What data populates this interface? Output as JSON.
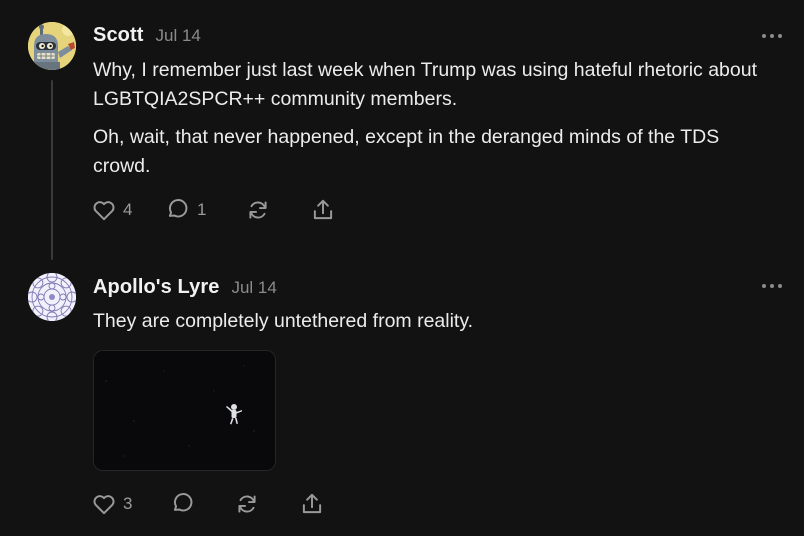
{
  "comments": [
    {
      "author": "Scott",
      "date": "Jul 14",
      "paragraphs": [
        "Why, I remember just last week when Trump was using hateful rhetoric about LGBTQIA2SPCR++ community members.",
        "Oh, wait, that never happened, except in the deranged minds of the TDS crowd."
      ],
      "likes": "4",
      "replies": "1",
      "avatar_icon": "robot-cartoon-avatar"
    },
    {
      "author": "Apollo's Lyre",
      "date": "Jul 14",
      "paragraphs": [
        "They are completely untethered from reality."
      ],
      "likes": "3",
      "replies": "",
      "avatar_icon": "mandala-pattern-avatar",
      "media": "astronaut-floating-in-space-image"
    }
  ],
  "colors": {
    "background": "#121212",
    "text": "#ececec",
    "muted": "#8b8b8b",
    "thread_line": "#3a3a3a"
  }
}
